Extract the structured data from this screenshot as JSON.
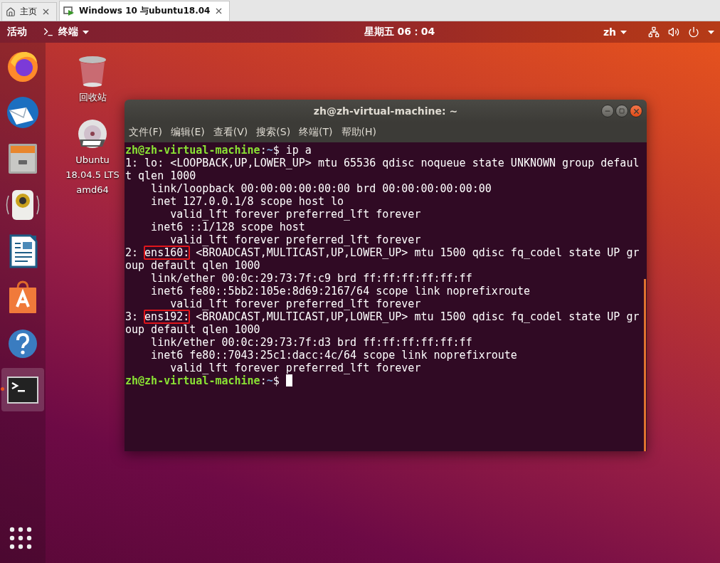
{
  "vm_tabs": [
    {
      "kind": "home",
      "label": "主页",
      "selected": false
    },
    {
      "kind": "vm",
      "label": "Windows 10 与ubuntu18.04",
      "selected": true
    }
  ],
  "top_panel": {
    "activities": "活动",
    "app_menu": "终端",
    "clock": "星期五 06：04",
    "input_method": "zh"
  },
  "dock": [
    {
      "kind": "browser",
      "selected": false
    },
    {
      "kind": "mail",
      "selected": false
    },
    {
      "kind": "files",
      "selected": false
    },
    {
      "kind": "music",
      "selected": false
    },
    {
      "kind": "writer",
      "selected": false
    },
    {
      "kind": "software",
      "selected": false
    },
    {
      "kind": "help",
      "selected": false
    },
    {
      "kind": "terminal",
      "selected": true
    }
  ],
  "desktop_icons": [
    {
      "kind": "trash",
      "label_lines": [
        "回收站"
      ]
    },
    {
      "kind": "dvd",
      "label_lines": [
        "Ubuntu",
        "18.04.5 LTS",
        "amd64"
      ]
    }
  ],
  "terminal": {
    "title": "zh@zh-virtual-machine: ~",
    "menu": [
      "文件(F)",
      "编辑(E)",
      "查看(V)",
      "搜索(S)",
      "终端(T)",
      "帮助(H)"
    ],
    "lines": [
      {
        "kind": "prompt",
        "user": "zh@zh-virtual-machine",
        "separator": ":",
        "path": "~",
        "sign": "$",
        "command": " ip a",
        "cursor": false
      },
      {
        "kind": "output",
        "text": "1: lo: <LOOPBACK,UP,LOWER_UP> mtu 65536 qdisc noqueue state UNKNOWN group defaul"
      },
      {
        "kind": "output",
        "text": "t qlen 1000"
      },
      {
        "kind": "output",
        "text": "    link/loopback 00:00:00:00:00:00 brd 00:00:00:00:00:00"
      },
      {
        "kind": "output",
        "text": "    inet 127.0.0.1/8 scope host lo"
      },
      {
        "kind": "output",
        "text": "       valid_lft forever preferred_lft forever"
      },
      {
        "kind": "output",
        "text": "    inet6 ::1/128 scope host"
      },
      {
        "kind": "output",
        "text": "       valid_lft forever preferred_lft forever"
      },
      {
        "kind": "boxed",
        "lead": "2: ",
        "boxed": "ens160:",
        "text": " <BROADCAST,MULTICAST,UP,LOWER_UP> mtu 1500 qdisc fq_codel state UP gr"
      },
      {
        "kind": "output",
        "text": "oup default qlen 1000"
      },
      {
        "kind": "output",
        "text": "    link/ether 00:0c:29:73:7f:c9 brd ff:ff:ff:ff:ff:ff"
      },
      {
        "kind": "output",
        "text": "    inet6 fe80::5bb2:105e:8d69:2167/64 scope link noprefixroute"
      },
      {
        "kind": "output",
        "text": "       valid_lft forever preferred_lft forever"
      },
      {
        "kind": "boxed",
        "lead": "3: ",
        "boxed": "ens192:",
        "text": " <BROADCAST,MULTICAST,UP,LOWER_UP> mtu 1500 qdisc fq_codel state UP gr"
      },
      {
        "kind": "output",
        "text": "oup default qlen 1000"
      },
      {
        "kind": "output",
        "text": "    link/ether 00:0c:29:73:7f:d3 brd ff:ff:ff:ff:ff:ff"
      },
      {
        "kind": "output",
        "text": "    inet6 fe80::7043:25c1:dacc:4c/64 scope link noprefixroute"
      },
      {
        "kind": "output",
        "text": "       valid_lft forever preferred_lft forever"
      },
      {
        "kind": "prompt",
        "user": "zh@zh-virtual-machine",
        "separator": ":",
        "path": "~",
        "sign": "$",
        "cursor": true
      }
    ]
  }
}
